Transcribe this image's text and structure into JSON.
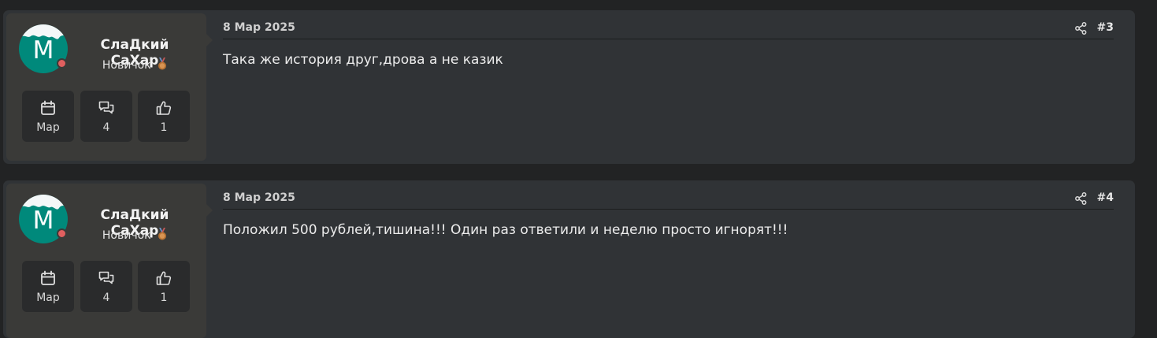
{
  "posts": [
    {
      "author": {
        "name": "СлаДкий СаХар",
        "avatar_letter": "M",
        "rank": "Новичок",
        "stats": {
          "joined": "Мар",
          "messages": "4",
          "reactions": "1"
        }
      },
      "date": "8 Мар 2025",
      "number": "#3",
      "text": "Така же история друг,дрова а не казик"
    },
    {
      "author": {
        "name": "СлаДкий СаХар",
        "avatar_letter": "M",
        "rank": "Новичок",
        "stats": {
          "joined": "Мар",
          "messages": "4",
          "reactions": "1"
        }
      },
      "date": "8 Мар 2025",
      "number": "#4",
      "text": "Положил 500 рублей,тишина!!! Один раз ответили и неделю просто игнорят!!!"
    }
  ],
  "colors": {
    "page_bg": "#222324",
    "post_bg": "#303336",
    "user_cell_bg": "#3a3a38",
    "avatar_bg": "#00897b",
    "status_offline": "#e05f5f"
  },
  "icons": {
    "stat_joined": "calendar-icon",
    "stat_messages": "chat-bubbles-icon",
    "stat_reactions": "thumbs-up-icon",
    "share": "share-icon",
    "rank": "medal-icon"
  }
}
